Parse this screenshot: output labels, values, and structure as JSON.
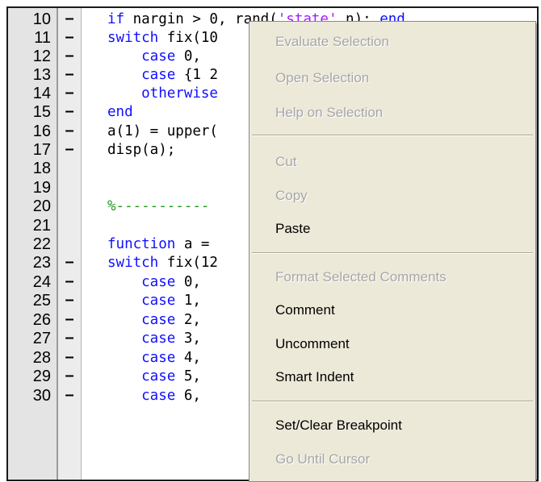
{
  "editor": {
    "lines": [
      {
        "num": "10",
        "dash": "–",
        "parts": [
          {
            "t": "if",
            "c": "kw"
          },
          {
            "t": " nargin > 0",
            "c": "txt"
          },
          {
            "t": ", rand(",
            "c": "txt"
          },
          {
            "t": "'state'",
            "c": "str"
          },
          {
            "t": ",n); ",
            "c": "txt"
          },
          {
            "t": "end",
            "c": "kw"
          }
        ]
      },
      {
        "num": "11",
        "dash": "–",
        "parts": [
          {
            "t": "switch",
            "c": "kw"
          },
          {
            "t": " fix(10",
            "c": "txt"
          }
        ]
      },
      {
        "num": "12",
        "dash": "–",
        "parts": [
          {
            "t": "    case",
            "c": "kw"
          },
          {
            "t": " 0,",
            "c": "txt"
          }
        ]
      },
      {
        "num": "13",
        "dash": "–",
        "parts": [
          {
            "t": "    case",
            "c": "kw"
          },
          {
            "t": " {1 2",
            "c": "txt"
          }
        ]
      },
      {
        "num": "14",
        "dash": "–",
        "parts": [
          {
            "t": "    otherwise",
            "c": "kw"
          }
        ]
      },
      {
        "num": "15",
        "dash": "–",
        "parts": [
          {
            "t": "end",
            "c": "kw"
          }
        ]
      },
      {
        "num": "16",
        "dash": "–",
        "parts": [
          {
            "t": "a(1) = upper(",
            "c": "txt"
          }
        ]
      },
      {
        "num": "17",
        "dash": "–",
        "parts": [
          {
            "t": "disp(a);",
            "c": "txt"
          }
        ]
      },
      {
        "num": "18",
        "dash": "",
        "parts": []
      },
      {
        "num": "19",
        "dash": "",
        "parts": []
      },
      {
        "num": "20",
        "dash": "",
        "parts": [
          {
            "t": "%-----------",
            "c": "cm"
          }
        ]
      },
      {
        "num": "21",
        "dash": "",
        "parts": []
      },
      {
        "num": "22",
        "dash": "",
        "parts": [
          {
            "t": "function",
            "c": "kw"
          },
          {
            "t": " a =",
            "c": "txt"
          }
        ]
      },
      {
        "num": "23",
        "dash": "–",
        "parts": [
          {
            "t": "switch",
            "c": "kw"
          },
          {
            "t": " fix(12",
            "c": "txt"
          }
        ]
      },
      {
        "num": "24",
        "dash": "–",
        "parts": [
          {
            "t": "    case",
            "c": "kw"
          },
          {
            "t": " 0,",
            "c": "txt"
          }
        ]
      },
      {
        "num": "25",
        "dash": "–",
        "parts": [
          {
            "t": "    case",
            "c": "kw"
          },
          {
            "t": " 1,",
            "c": "txt"
          }
        ]
      },
      {
        "num": "26",
        "dash": "–",
        "parts": [
          {
            "t": "    case",
            "c": "kw"
          },
          {
            "t": " 2,",
            "c": "txt"
          }
        ]
      },
      {
        "num": "27",
        "dash": "–",
        "parts": [
          {
            "t": "    case",
            "c": "kw"
          },
          {
            "t": " 3,",
            "c": "txt"
          }
        ]
      },
      {
        "num": "28",
        "dash": "–",
        "parts": [
          {
            "t": "    case",
            "c": "kw"
          },
          {
            "t": " 4,",
            "c": "txt"
          }
        ]
      },
      {
        "num": "29",
        "dash": "–",
        "parts": [
          {
            "t": "    case",
            "c": "kw"
          },
          {
            "t": " 5,",
            "c": "txt"
          }
        ]
      },
      {
        "num": "30",
        "dash": "–",
        "parts": [
          {
            "t": "    case",
            "c": "kw"
          },
          {
            "t": " 6,",
            "c": "txt"
          }
        ]
      }
    ]
  },
  "context_menu": {
    "evaluate_selection": "Evaluate Selection",
    "open_selection": "Open Selection",
    "help_on_selection": "Help on Selection",
    "cut": "Cut",
    "copy": "Copy",
    "paste": "Paste",
    "format_selected_comments": "Format Selected Comments",
    "comment": "Comment",
    "uncomment": "Uncomment",
    "smart_indent": "Smart Indent",
    "set_clear_breakpoint": "Set/Clear Breakpoint",
    "go_until_cursor": "Go Until Cursor"
  },
  "colors": {
    "keyword": "#1010ff",
    "comment": "#1f9a1f",
    "string": "#a020f0",
    "menu_background": "#ece9d8",
    "disabled_text": "#a7a6aa"
  }
}
